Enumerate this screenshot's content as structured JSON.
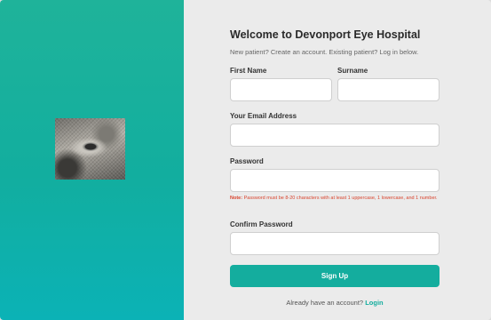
{
  "form": {
    "title": "Welcome to Devonport Eye Hospital",
    "subtitle": "New patient? Create an account. Existing patient? Log in below.",
    "first_name_label": "First Name",
    "first_name_value": "",
    "surname_label": "Surname",
    "surname_value": "",
    "email_label": "Your Email Address",
    "email_value": "",
    "password_label": "Password",
    "password_value": "",
    "note_prefix": "Note:",
    "note_text": " Password must be 8-20 characters with at least 1 uppercase, 1 lowercase, and 1 number.",
    "confirm_password_label": "Confirm Password",
    "confirm_password_value": "",
    "signup_label": "Sign Up",
    "footer_text": "Already have an account?",
    "login_link": "Login"
  },
  "colors": {
    "accent": "#14ad9e",
    "note": "#d9452f",
    "panel_gradient_top": "#1fb39a",
    "panel_gradient_bottom": "#0bb2b6"
  }
}
